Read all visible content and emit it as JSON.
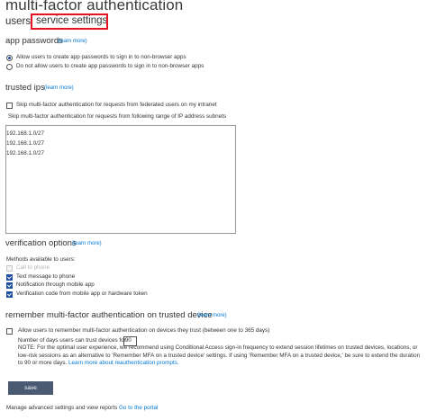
{
  "page": {
    "title": "multi-factor authentication",
    "tabs": [
      {
        "label": "users"
      },
      {
        "label": "service settings",
        "selected": true
      }
    ]
  },
  "app_passwords": {
    "heading": "app passwords",
    "learn_more": "(learn more)",
    "options": [
      {
        "label": "Allow users to create app passwords to sign in to non-browser apps",
        "selected": true
      },
      {
        "label": "Do not allow users to create app passwords to sign in to non-browser apps",
        "selected": false
      }
    ]
  },
  "trusted_ips": {
    "heading": "trusted ips",
    "learn_more": "(learn more)",
    "skip_federated_label": "Skip multi-factor authentication for requests from federated users on my intranet",
    "skip_federated_checked": false,
    "range_description": "Skip multi-factor authentication for requests from following range of IP address subnets",
    "ip_ranges": [
      "192.168.1.0/27",
      "192.168.1.0/27",
      "192.168.1.0/27"
    ]
  },
  "verification_options": {
    "heading": "verification options",
    "learn_more": "(learn more)",
    "methods_label": "Methods available to users:",
    "methods": [
      {
        "label": "Call to phone",
        "checked": false,
        "disabled": true
      },
      {
        "label": "Text message to phone",
        "checked": true,
        "disabled": false
      },
      {
        "label": "Notification through mobile app",
        "checked": true,
        "disabled": false
      },
      {
        "label": "Verification code from mobile app or hardware token",
        "checked": true,
        "disabled": false
      }
    ]
  },
  "remember_mfa": {
    "heading": "remember multi-factor authentication on trusted device",
    "learn_more": "(learn more)",
    "allow_label": "Allow users to remember multi-factor authentication on devices they trust (between one to 365 days)",
    "allow_checked": false,
    "days_label": "Number of days users can trust devices for",
    "days_value": "90",
    "note_text": "NOTE: For the optimal user experience, we recommend using Conditional Access sign-in frequency to extend session lifetimes on trusted devices, locations, or low-risk sessions as an alternative to 'Remember MFA on a trusted device' settings. If using 'Remember MFA on a trusted device,' be sure to extend the duration to 90 or more days. ",
    "note_link": "Learn more about reauthentication prompts."
  },
  "actions": {
    "save_label": "save"
  },
  "footer": {
    "text": "Manage advanced settings and view reports ",
    "link": "Go to the portal"
  },
  "colors": {
    "link": "#0078d4",
    "highlight_border": "#e81123",
    "save_button": "#4a5a72",
    "checked": "#1f4e9e"
  }
}
